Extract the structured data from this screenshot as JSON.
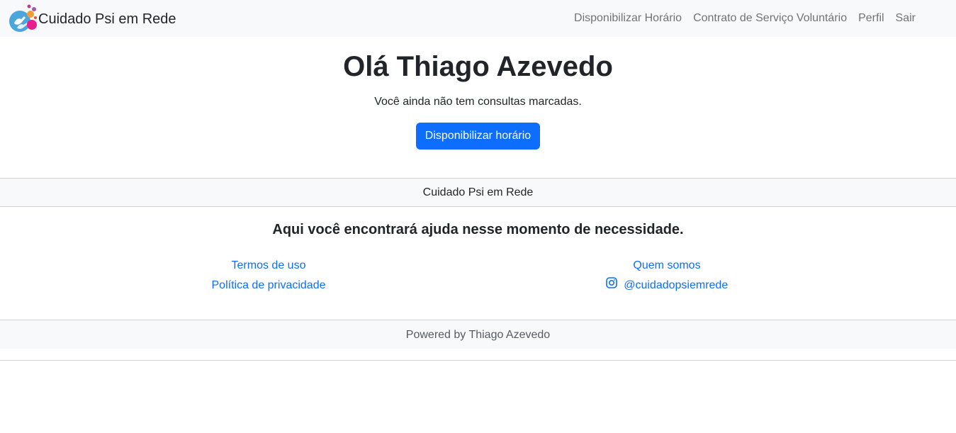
{
  "navbar": {
    "brand": "Cuidado Psi em Rede",
    "links": [
      {
        "label": "Disponibilizar Horário"
      },
      {
        "label": "Contrato de Serviço Voluntário"
      },
      {
        "label": "Perfil"
      },
      {
        "label": "Sair"
      }
    ]
  },
  "hero": {
    "greeting": "Olá Thiago Azevedo",
    "message": "Você ainda não tem consultas marcadas.",
    "button_label": "Disponibilizar horário"
  },
  "footer": {
    "band_title": "Cuidado Psi em Rede",
    "tagline": "Aqui você encontrará ajuda nesse momento de necessidade.",
    "left_links": [
      {
        "label": "Termos de uso"
      },
      {
        "label": "Política de privacidade"
      }
    ],
    "right_links": [
      {
        "label": "Quem somos"
      },
      {
        "label": "@cuidadopsiemrede",
        "icon": "instagram-icon"
      }
    ],
    "powered_by": "Powered by Thiago Azevedo"
  },
  "colors": {
    "primary": "#0d6efd",
    "navbar_bg": "#f8f9fa",
    "text": "#212529"
  }
}
